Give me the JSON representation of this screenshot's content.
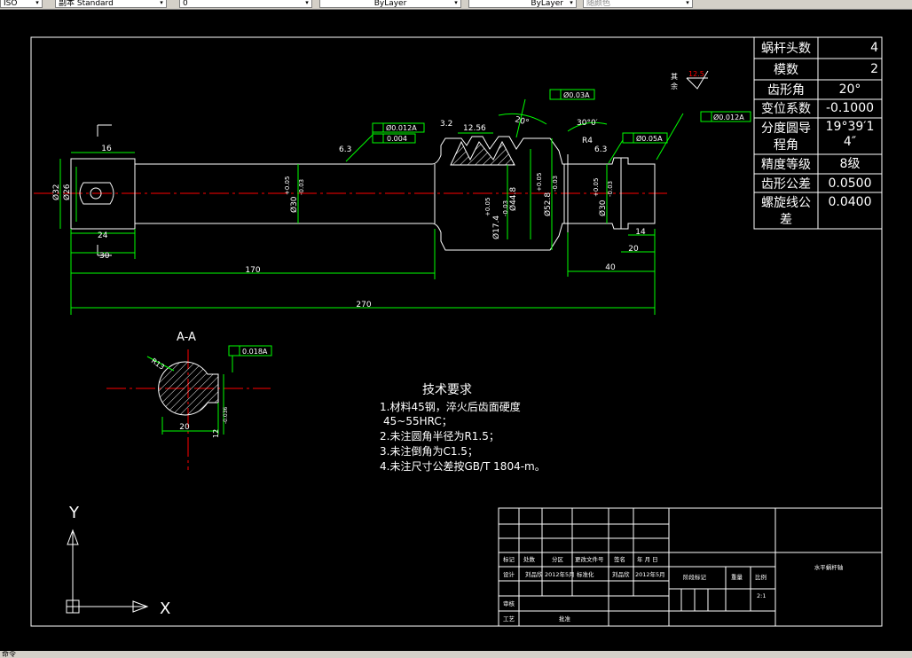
{
  "toolbar": {
    "items": [
      {
        "label": "ISO"
      },
      {
        "label": "副本 Standard"
      },
      {
        "label": "0"
      },
      {
        "label": "ByLayer"
      },
      {
        "label": "ByLayer"
      },
      {
        "label": "随颜色"
      }
    ]
  },
  "status": {
    "text": "命令"
  },
  "colors": {
    "background": "#000000",
    "frame": "#ffffff",
    "dimension": "#00ff00",
    "centerline": "#ff0000",
    "text": "#ffffff"
  },
  "param_table": [
    {
      "label": "蜗杆头数",
      "value": "4"
    },
    {
      "label": "模数",
      "value": "2"
    },
    {
      "label": "齿形角",
      "value": "20°"
    },
    {
      "label": "变位系数",
      "value": "-0.1000"
    },
    {
      "label": "分度圆导",
      "label2": "程角",
      "value": "19°39′1",
      "value2": "4″"
    },
    {
      "label": "精度等级",
      "value": "8级"
    },
    {
      "label": "齿形公差",
      "value": "0.0500"
    },
    {
      "label": "螺旋线公",
      "label2": "差",
      "value": "0.0400"
    }
  ],
  "dims": {
    "d16": "16",
    "d24": "24",
    "d30": "30",
    "d170": "170",
    "d270": "270",
    "d40": "40",
    "d20": "20",
    "d14": "14",
    "d12_56": "12.56",
    "d3_2": "3.2",
    "d6_3a": "6.3",
    "d6_3b": "6.3",
    "r4": "R4",
    "ang20": "20°",
    "ang30": "30°0′",
    "phi32": "Ø32",
    "phi26": "Ø26",
    "phi30a": "Ø30",
    "tol_a": "+0.05",
    "tol_b": "-0.03",
    "phi30b": "Ø30",
    "tol_c": "+0.05",
    "tol_d": "-0.03",
    "phi44_8": "Ø44.8",
    "phi52_8": "Ø52.8",
    "tol_e": "+0.05",
    "tol_f": "-0.03",
    "phi17_4": "Ø17.4",
    "tol_g": "+0.05",
    "tol_h": "-0.03",
    "tol1": "Ø0.012A",
    "tol2": "0.004",
    "tol3": "Ø0.03A",
    "tol4": "Ø0.05A",
    "tol5": "Ø0.012A",
    "rough_label1": "其",
    "rough_label2": "余",
    "rough_val": "12.5"
  },
  "section": {
    "title": "A-A",
    "r13": "R13",
    "d20": "20",
    "d12": "12",
    "tol": "-0.036",
    "sym_tol": "0.018A"
  },
  "tech": {
    "title": "技术要求",
    "lines": [
      "1.材料45钢，淬火后齿面硬度",
      "45~55HRC；",
      "2.未注圆角半径为R1.5；",
      "3.未注倒角为C1.5；",
      "4.未注尺寸公差按GB/T 1804-m。"
    ]
  },
  "ucs": {
    "y": "Y",
    "x": "X"
  },
  "title_block": {
    "row_labels": [
      "标记",
      "处数",
      "分区",
      "更改文件号",
      "签名",
      "年 月 日"
    ],
    "design": "设计",
    "designer": "刘品欣",
    "date1": "2012年5月",
    "std": "标准化",
    "checker": "刘品欣",
    "date2": "2012年5月",
    "stage": "阶段标记",
    "weight": "重量",
    "scale": "比例",
    "scale_val": "2:1",
    "review": "审核",
    "process": "工艺",
    "approve": "批准",
    "drawing_name": "水平蜗杆轴"
  }
}
